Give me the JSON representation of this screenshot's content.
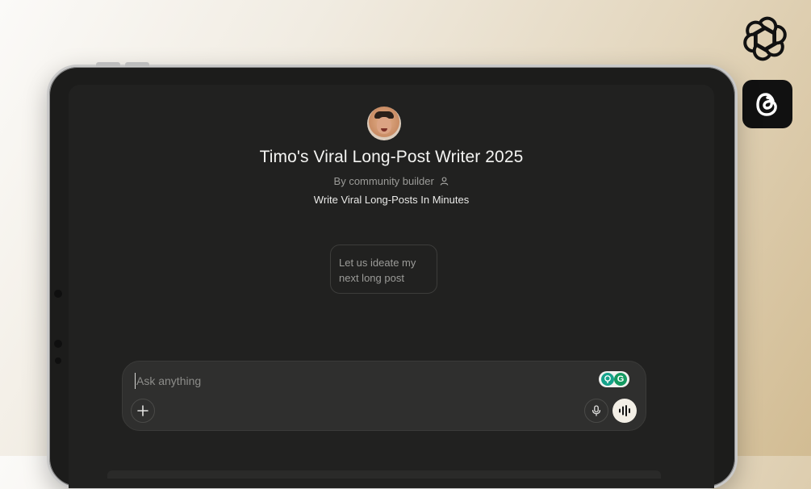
{
  "gpt": {
    "title": "Timo's Viral Long-Post Writer 2025",
    "byline": "By community builder",
    "description": "Write Viral Long-Posts In Minutes"
  },
  "starters": [
    {
      "label": "Let us ideate my next long post"
    }
  ],
  "composer": {
    "placeholder": "Ask anything",
    "extension_letter": "G"
  },
  "icons": {
    "person": "person-icon",
    "plus": "plus-icon",
    "mic": "microphone-icon",
    "voice": "voice-waveform-icon",
    "openai": "openai-logo",
    "threads": "threads-logo"
  },
  "colors": {
    "screen_bg": "#212120",
    "composer_bg": "#2f2f2e",
    "voice_button": "#f3efe6",
    "extension_green": "#149a61"
  }
}
